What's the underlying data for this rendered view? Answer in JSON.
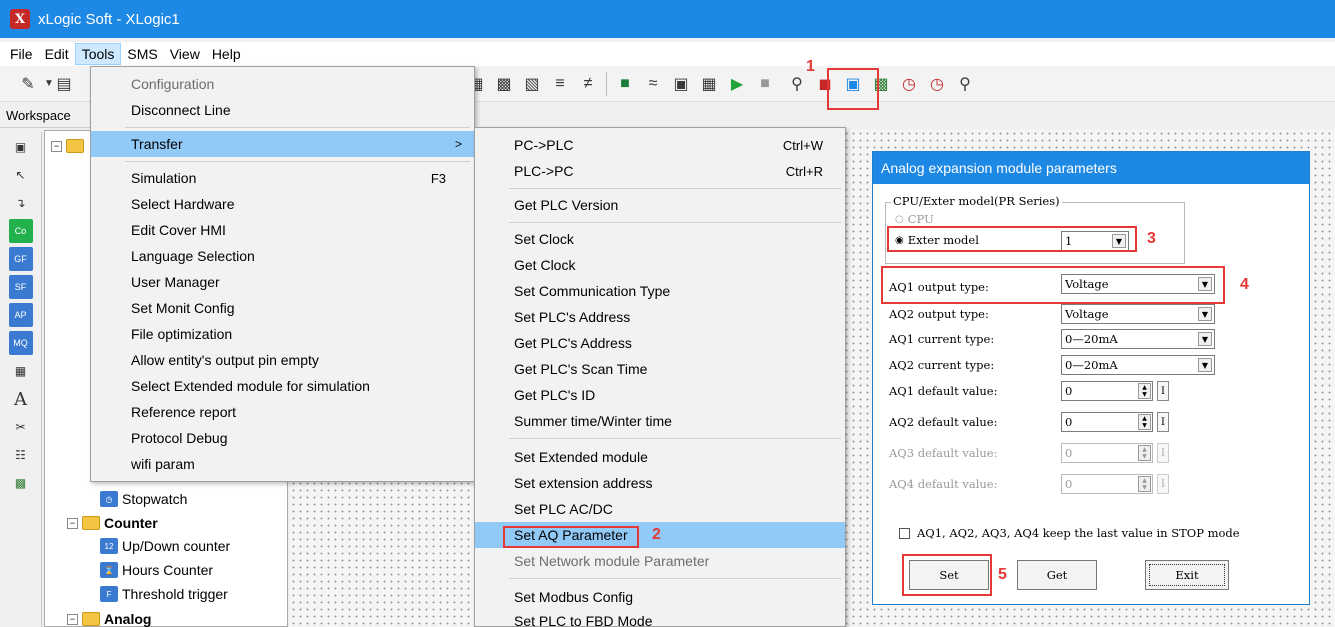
{
  "window": {
    "title": "xLogic Soft - XLogic1",
    "icon_letter": "X"
  },
  "menubar": {
    "items": [
      {
        "label": "File"
      },
      {
        "label": "Edit"
      },
      {
        "label": "Tools"
      },
      {
        "label": "SMS"
      },
      {
        "label": "View"
      },
      {
        "label": "Help"
      }
    ]
  },
  "workspace": {
    "label": "Workspace"
  },
  "left_icons": [
    "Co",
    "GF",
    "SF",
    "AP",
    "MQ"
  ],
  "tree": {
    "stopwatch": "Stopwatch",
    "counter": "Counter",
    "updown": "Up/Down counter",
    "hours": "Hours Counter",
    "threshold": "Threshold trigger",
    "analog": "Analog"
  },
  "tools_menu": {
    "items": [
      {
        "label": "Configuration"
      },
      {
        "label": "Disconnect Line"
      },
      {
        "label": "Transfer"
      },
      {
        "label": "Simulation",
        "shortcut": "F3"
      },
      {
        "label": "Select Hardware"
      },
      {
        "label": "Edit Cover HMI"
      },
      {
        "label": "Language Selection"
      },
      {
        "label": "User Manager"
      },
      {
        "label": "Set Monit Config"
      },
      {
        "label": "File optimization"
      },
      {
        "label": "Allow entity's output pin empty"
      },
      {
        "label": "Select Extended module for simulation"
      },
      {
        "label": "Reference report"
      },
      {
        "label": "Protocol Debug"
      },
      {
        "label": "wifi param"
      }
    ],
    "arrow": ">"
  },
  "transfer_menu": {
    "items": [
      {
        "label": "PC->PLC",
        "shortcut": "Ctrl+W"
      },
      {
        "label": "PLC->PC",
        "shortcut": "Ctrl+R"
      },
      {
        "label": "Get PLC Version"
      },
      {
        "label": "Set Clock"
      },
      {
        "label": "Get Clock"
      },
      {
        "label": "Set Communication Type"
      },
      {
        "label": "Set PLC's Address"
      },
      {
        "label": "Get PLC's Address"
      },
      {
        "label": "Get PLC's Scan Time"
      },
      {
        "label": "Get PLC's ID"
      },
      {
        "label": "Summer time/Winter time"
      },
      {
        "label": "Set Extended module"
      },
      {
        "label": "Set extension address"
      },
      {
        "label": "Set PLC AC/DC"
      },
      {
        "label": "Set AQ Parameter"
      },
      {
        "label": "Set Network module Parameter"
      },
      {
        "label": "Set Modbus Config"
      },
      {
        "label": "Set PLC to FBD Mode"
      }
    ]
  },
  "dialog": {
    "title": "Analog  expansion module parameters",
    "group_label": "CPU/Exter model(PR Series)",
    "radio_cpu": "CPU",
    "radio_exter": "Exter model",
    "exter_value": "1",
    "rows": [
      {
        "label": "AQ1 output type:",
        "value": "Voltage"
      },
      {
        "label": "AQ2 output type:",
        "value": "Voltage"
      },
      {
        "label": "AQ1 current type:",
        "value": "0—20mA"
      },
      {
        "label": "AQ2 current type:",
        "value": "0—20mA"
      }
    ],
    "defaults": [
      {
        "label": "AQ1 default value:",
        "value": "0"
      },
      {
        "label": "AQ2 default value:",
        "value": "0"
      },
      {
        "label": "AQ3 default value:",
        "value": "0"
      },
      {
        "label": "AQ4 default value:",
        "value": "0"
      }
    ],
    "i_label": "I",
    "keep_label": "AQ1, AQ2, AQ3, AQ4 keep the last value in STOP mode",
    "btn_set": "Set",
    "btn_get": "Get",
    "btn_exit": "Exit"
  },
  "annotations": [
    "1",
    "2",
    "3",
    "4",
    "5"
  ],
  "colors": {
    "titlebar": "#1e88e5",
    "highlight": "#91c9f7",
    "annotation": "#e53935"
  }
}
